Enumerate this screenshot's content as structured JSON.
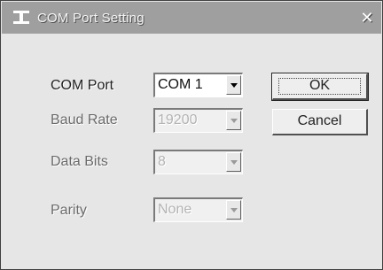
{
  "window": {
    "title": "COM Port Setting",
    "close_glyph": "✕",
    "title_icon": "serial-port-icon"
  },
  "fields": {
    "com_port": {
      "label": "COM Port",
      "value": "COM 1"
    },
    "baud_rate": {
      "label": "Baud Rate",
      "value": "19200"
    },
    "data_bits": {
      "label": "Data Bits",
      "value": "8"
    },
    "parity": {
      "label": "Parity",
      "value": "None"
    }
  },
  "buttons": {
    "ok": "OK",
    "cancel": "Cancel"
  }
}
